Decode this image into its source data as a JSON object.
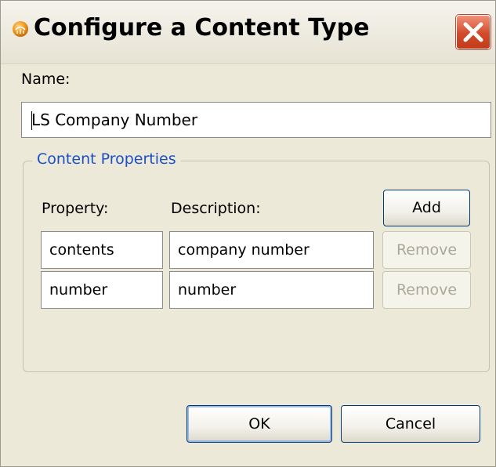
{
  "window": {
    "title": "Configure a Content Type"
  },
  "name_field": {
    "label": "Name:",
    "value": "LS Company Number"
  },
  "content_properties": {
    "legend": "Content Properties",
    "property_header": "Property:",
    "description_header": "Description:",
    "add_label": "Add",
    "rows": [
      {
        "property": "contents",
        "description": "company number",
        "remove_label": "Remove"
      },
      {
        "property": "number",
        "description": "number",
        "remove_label": "Remove"
      }
    ]
  },
  "buttons": {
    "ok_label": "OK",
    "cancel_label": "Cancel"
  },
  "icons": {
    "app": "app-logo-icon",
    "close": "close-icon"
  },
  "colors": {
    "dialog_background": "#ece9d8",
    "legend_text": "#1b4fc8",
    "close_button": "#d24a29",
    "disabled_text": "#aca899"
  }
}
